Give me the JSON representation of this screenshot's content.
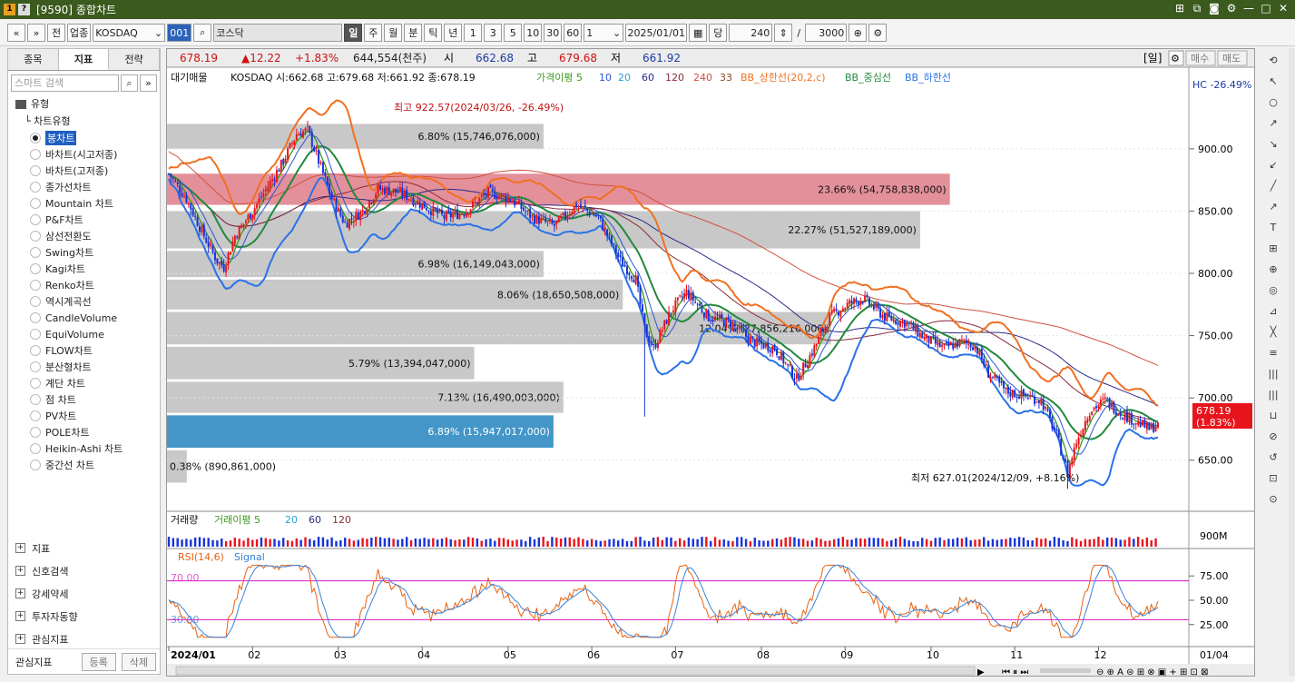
{
  "window": {
    "id": "[9590]",
    "title": "종합차트"
  },
  "toolbar": {
    "market": "업종",
    "code": "KOSDAQ",
    "code_suffix": "001",
    "name": "코스닥",
    "periods": [
      "일",
      "주",
      "월",
      "분",
      "틱",
      "년"
    ],
    "counts": [
      "1",
      "3",
      "5",
      "10",
      "30",
      "60"
    ],
    "unit": "1",
    "date": "2025/01/01",
    "dang": "당",
    "bars": "240",
    "total": "3000",
    "jeon": "전"
  },
  "left": {
    "tabs": [
      "종목",
      "지표",
      "전략"
    ],
    "search_placeholder": "스마트 검색",
    "group": "유형",
    "subgroup": "차트유형",
    "items": [
      "봉차트",
      "바차트(시고저종)",
      "바차트(고저종)",
      "종가선차트",
      "Mountain 차트",
      "P&F차트",
      "삼선전환도",
      "Swing차트",
      "Kagi차트",
      "Renko차트",
      "역시계곡선",
      "CandleVolume",
      "EquiVolume",
      "FLOW차트",
      "분산형차트",
      "계단 차트",
      "점 차트",
      "PV차트",
      "POLE차트",
      "Heikin-Ashi 차트",
      "중간선 차트"
    ],
    "folders": [
      "지표",
      "신호검색",
      "강세약세",
      "투자자동향",
      "관심지표"
    ],
    "fav_label": "관심지표",
    "fav_add": "등록",
    "fav_del": "삭제"
  },
  "quote": {
    "price": "678.19",
    "change": "▲12.22",
    "pct": "+1.83%",
    "volume": "644,554(천주)",
    "open_l": "시",
    "open": "662.68",
    "high_l": "고",
    "high": "679.68",
    "low_l": "저",
    "low": "661.92",
    "period_tag": "[일]",
    "buy": "매수",
    "sell": "매도"
  },
  "legend": {
    "main": "대기매물",
    "ohlc": "KOSDAQ 시:662.68 고:679.68 저:661.92 종:678.19",
    "ma_label": "가격이평 5",
    "ma": [
      "10",
      "20",
      "60",
      "120",
      "240",
      "33"
    ],
    "bbu": "BB_상한선(20,2,c)",
    "bbm": "BB_중심선",
    "bbl": "BB_하한선",
    "hc": "HC -26.49%"
  },
  "colors": {
    "up": "#e8141c",
    "down": "#1633d8",
    "ma5": "#3c9a1c",
    "ma10": "#2a55d0",
    "ma20": "#2e8b3e",
    "ma60": "#2a2a8a",
    "ma120": "#8a2a3a",
    "ma240": "#d05040",
    "bbu": "#f07020",
    "bbl": "#2a72e8",
    "bbm": "#22883c",
    "supply": "#c8c8c8",
    "supply_hot": "#e3909a",
    "supply_cur": "#4496c8",
    "rsi": "#e86010",
    "signal": "#3a82d8",
    "rsiband": "#d814c8"
  },
  "price_axis": {
    "ticks": [
      "900.00",
      "850.00",
      "800.00",
      "750.00",
      "700.00",
      "650.00"
    ],
    "values": [
      900,
      850,
      800,
      750,
      700,
      650
    ],
    "ymax": 940,
    "ymin": 617,
    "last_label": "678.19",
    "last_pct": "(1.83%)"
  },
  "supply": [
    {
      "lo": 900,
      "hi": 920,
      "label": "6.80% (15,746,076,000)",
      "w": 0.38
    },
    {
      "lo": 855,
      "hi": 880,
      "label": "23.66% (54,758,838,000)",
      "w": 0.79,
      "hot": true
    },
    {
      "lo": 820,
      "hi": 850,
      "label": "22.27% (51,527,189,000)",
      "w": 0.76
    },
    {
      "lo": 797,
      "hi": 818,
      "label": "6.98% (16,149,043,000)",
      "w": 0.38
    },
    {
      "lo": 771,
      "hi": 795,
      "label": "8.06% (18,650,508,000)",
      "w": 0.46
    },
    {
      "lo": 743,
      "hi": 769,
      "label": "12.04% (27,856,216,000)",
      "w": 0.67
    },
    {
      "lo": 715,
      "hi": 741,
      "label": "5.79% (13,394,047,000)",
      "w": 0.31
    },
    {
      "lo": 688,
      "hi": 713,
      "label": "7.13% (16,490,003,000)",
      "w": 0.4
    },
    {
      "lo": 660,
      "hi": 686,
      "label": "6.89% (15,947,017,000)",
      "w": 0.39,
      "cur": true
    },
    {
      "lo": 632,
      "hi": 658,
      "label": "0.38% (890,861,000)",
      "w": 0.02
    }
  ],
  "annotations": {
    "high": "최고 922.57(2024/03/26, -26.49%)",
    "low": "최저 627.01(2024/12/09, +8.16%)"
  },
  "volume": {
    "label": "거래량",
    "ma_label": "거래이평 5",
    "ma": [
      "20",
      "60",
      "120"
    ],
    "tick": "900M"
  },
  "rsi": {
    "label": "RSI(14,6)",
    "signal": "Signal",
    "upper": "70.00",
    "lower": "30.00",
    "ticks": [
      "75.00",
      "50.00",
      "25.00"
    ],
    "values": [
      75,
      50,
      25
    ]
  },
  "xaxis": {
    "labels": [
      "2024/01",
      "02",
      "03",
      "04",
      "05",
      "06",
      "07",
      "08",
      "09",
      "10",
      "11",
      "12"
    ],
    "end": "01/04"
  },
  "chart_data": {
    "type": "candlestick",
    "anchors": [
      [
        0,
        880
      ],
      [
        8,
        860
      ],
      [
        16,
        830
      ],
      [
        22,
        810
      ],
      [
        25,
        805
      ],
      [
        30,
        830
      ],
      [
        38,
        850
      ],
      [
        45,
        870
      ],
      [
        52,
        890
      ],
      [
        58,
        912
      ],
      [
        63,
        915
      ],
      [
        68,
        890
      ],
      [
        74,
        860
      ],
      [
        80,
        840
      ],
      [
        88,
        850
      ],
      [
        95,
        868
      ],
      [
        105,
        865
      ],
      [
        115,
        855
      ],
      [
        125,
        845
      ],
      [
        135,
        850
      ],
      [
        145,
        865
      ],
      [
        155,
        860
      ],
      [
        165,
        845
      ],
      [
        175,
        838
      ],
      [
        185,
        855
      ],
      [
        195,
        845
      ],
      [
        205,
        810
      ],
      [
        212,
        795
      ],
      [
        216,
        755
      ],
      [
        220,
        740
      ],
      [
        228,
        770
      ],
      [
        235,
        785
      ],
      [
        245,
        765
      ],
      [
        255,
        760
      ],
      [
        265,
        745
      ],
      [
        275,
        740
      ],
      [
        285,
        715
      ],
      [
        293,
        740
      ],
      [
        300,
        765
      ],
      [
        308,
        775
      ],
      [
        315,
        780
      ],
      [
        325,
        765
      ],
      [
        335,
        760
      ],
      [
        343,
        748
      ],
      [
        352,
        740
      ],
      [
        360,
        745
      ],
      [
        366,
        742
      ],
      [
        372,
        720
      ],
      [
        380,
        705
      ],
      [
        388,
        702
      ],
      [
        396,
        698
      ],
      [
        403,
        670
      ],
      [
        408,
        640
      ],
      [
        412,
        665
      ],
      [
        418,
        690
      ],
      [
        425,
        698
      ],
      [
        432,
        688
      ],
      [
        440,
        680
      ],
      [
        445,
        675
      ],
      [
        448,
        678
      ]
    ]
  }
}
